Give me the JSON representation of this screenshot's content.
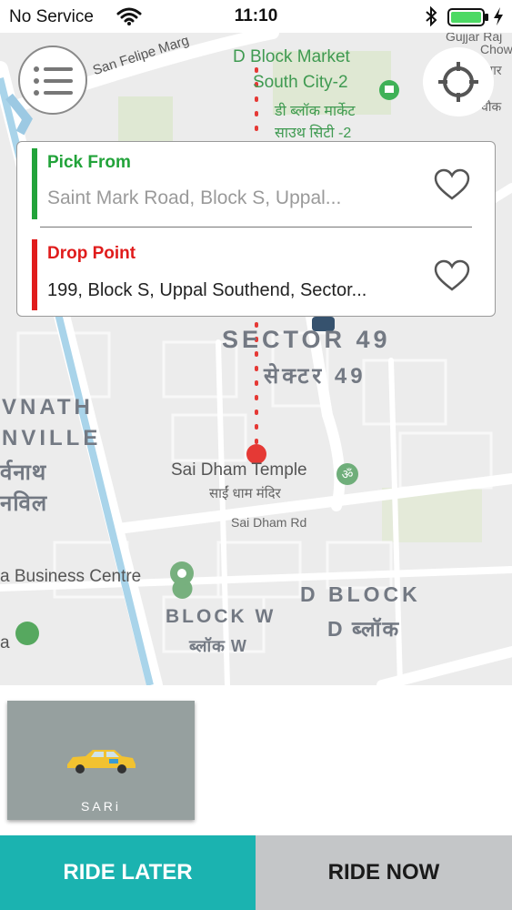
{
  "status_bar": {
    "carrier": "No Service",
    "time": "11:10",
    "icons": [
      "wifi-icon",
      "bluetooth-icon",
      "battery-icon",
      "charging-icon"
    ],
    "battery_color": "#4cd964"
  },
  "map": {
    "labels": {
      "d_block_market_en": "D Block Market",
      "south_city_en": "South City-2",
      "d_block_market_hi": "डी ब्लॉक मार्केट",
      "south_city_hi": "साउथ सिटी -2",
      "san_felipe": "San Felipe Marg",
      "sector49_en": "SECTOR 49",
      "sector49_hi": "सेक्टर 49",
      "vnath": "VNATH",
      "nville": "NVILLE",
      "vnath_hi": "र्वनाथ",
      "nville_hi": "नविल",
      "sai_dham_en": "Sai Dham Temple",
      "sai_dham_hi": "साईं धाम मंदिर",
      "sai_dham_rd": "Sai Dham Rd",
      "business_centre": "a Business Centre",
      "block_w_en": "BLOCK W",
      "block_w_hi": "ब्लॉक W",
      "d_block_en": "D BLOCK",
      "d_block_hi": "D ब्लॉक",
      "gujjar_top": "Gujjar Raj",
      "chow": "Chow",
      "right_hi1": "गर",
      "right_hi2": "चौक",
      "a_label": "a"
    },
    "route_color": "#e53935"
  },
  "address_card": {
    "pickup": {
      "title": "Pick From",
      "value": "Saint Mark Road, Block S, Uppal...",
      "color": "#22a33a"
    },
    "drop": {
      "title": "Drop Point",
      "value": "199, Block S, Uppal Southend, Sector...",
      "color": "#e01c1c"
    }
  },
  "vehicle": {
    "name": "SARi",
    "icon": "taxi-icon"
  },
  "actions": {
    "ride_later": "RIDE LATER",
    "ride_now": "RIDE NOW",
    "ride_later_color": "#1bb3b0",
    "ride_now_color": "#c4c6c8"
  }
}
